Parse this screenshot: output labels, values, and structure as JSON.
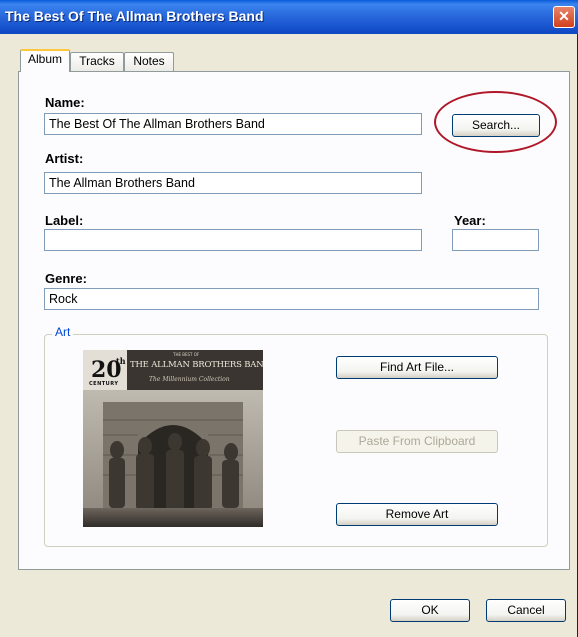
{
  "window": {
    "title": "The Best Of The Allman Brothers Band",
    "close_glyph": "✕"
  },
  "tabs": [
    {
      "label": "Album",
      "active": true
    },
    {
      "label": "Tracks",
      "active": false
    },
    {
      "label": "Notes",
      "active": false
    }
  ],
  "form": {
    "name_label": "Name:",
    "name_value": "The Best Of The Allman Brothers Band",
    "search_label": "Search...",
    "artist_label": "Artist:",
    "artist_value": "The Allman Brothers Band",
    "label_label": "Label:",
    "label_value": "",
    "year_label": "Year:",
    "year_value": "",
    "genre_label": "Genre:",
    "genre_value": "Rock"
  },
  "art": {
    "group_title": "Art",
    "find_label": "Find Art File...",
    "paste_label": "Paste From Clipboard",
    "remove_label": "Remove Art",
    "cover": {
      "badge_number": "20",
      "badge_suffix": "th",
      "badge_text": "CENTURY",
      "top_small": "THE BEST OF",
      "band": "THE ALLMAN BROTHERS BAND",
      "sub": "The Millennium Collection"
    }
  },
  "footer": {
    "ok_label": "OK",
    "cancel_label": "Cancel"
  },
  "colors": {
    "title_bar": "#2462d8",
    "highlight": "#b0182a",
    "group_title": "#0046d5"
  }
}
